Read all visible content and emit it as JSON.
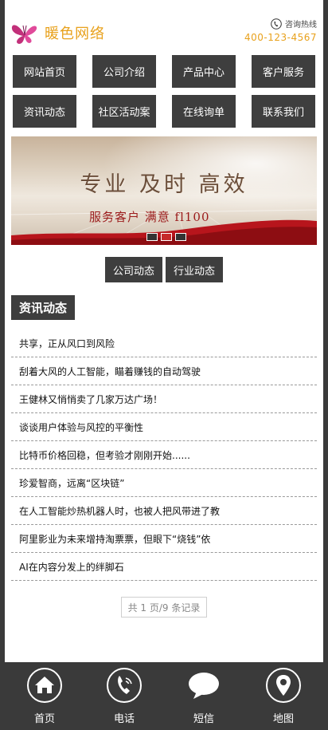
{
  "header": {
    "logo_text": "暖色网络",
    "hotline_label": "咨询热线",
    "hotline_number": "400-123-4567"
  },
  "nav": {
    "row1": [
      "网站首页",
      "公司介绍",
      "产品中心",
      "客户服务"
    ],
    "row2": [
      "资讯动态",
      "社区活动案",
      "在线询单",
      "联系我们"
    ]
  },
  "banner": {
    "title": "专业  及时  高效",
    "subtitle": "服务客户 满意 fl100",
    "active_slide": 2,
    "slide_count": 3
  },
  "tabs": [
    "公司动态",
    "行业动态"
  ],
  "section": {
    "title": "资讯动态"
  },
  "news": [
    "共享，正从风口到风险",
    "刮着大风的人工智能，瞄着赚钱的自动驾驶",
    "王健林又悄悄卖了几家万达广场！",
    "谈谈用户体验与风控的平衡性",
    "比特币价格回稳，但考验才刚刚开始......",
    "珍爱智商，远离“区块链”",
    "在人工智能炒热机器人时，也被人把风带进了教",
    "阿里影业为未来增持淘票票，但眼下“烧钱”依",
    "AI在内容分发上的绊脚石"
  ],
  "pager": {
    "text": "共 1 页/9 条记录"
  },
  "footer": {
    "items": [
      {
        "label": "首页",
        "icon": "home-icon"
      },
      {
        "label": "电话",
        "icon": "phone-icon"
      },
      {
        "label": "短信",
        "icon": "message-icon"
      },
      {
        "label": "地图",
        "icon": "map-pin-icon"
      }
    ]
  },
  "colors": {
    "accent": "#e8a11c",
    "dark": "#3e3e3e",
    "banner_red": "#c62a2a"
  }
}
